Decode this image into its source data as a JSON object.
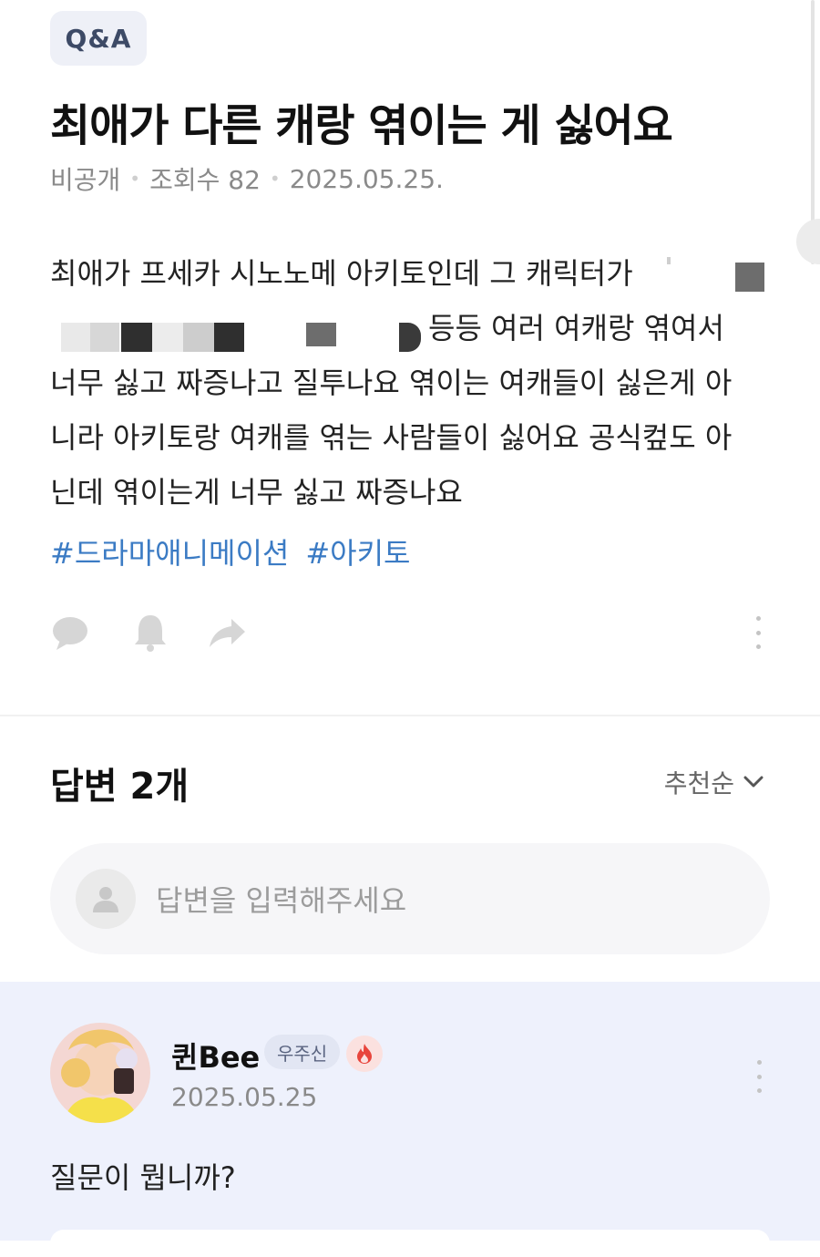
{
  "post": {
    "badge": "Q&A",
    "title": "최애가 다른 캐랑 엮이는 게 싫어요",
    "meta": {
      "visibility": "비공개",
      "views": "조회수 82",
      "date": "2025.05.25."
    },
    "body_line1": "최애가 프세카 시노노메 아키토인데 그 캐릭터가",
    "body_line2_tail": "등등 여러 여캐랑 엮여서",
    "body_line3": "너무 싫고 짜증나고 질투나요 엮이는 여캐들이 싫은게 아",
    "body_line4": "니라 아키토랑 여캐를 엮는 사람들이 싫어요 공식컾도 아",
    "body_line5": "닌데 엮이는게 너무 싫고 짜증나요",
    "tags": [
      "#드라마애니메이션",
      "#아키토"
    ]
  },
  "actions": {
    "comment_icon": "speech-bubble-icon",
    "subscribe_icon": "bell-icon",
    "share_icon": "share-arrow-icon",
    "more_icon": "kebab-menu-icon"
  },
  "answers": {
    "count_label": "답변 2개",
    "sort_label": "추천순",
    "input_placeholder": "답변을 입력해주세요"
  },
  "answer": {
    "author": "퀸Bee",
    "grade": "우주신",
    "date": "2025.05.25",
    "text": "질문이 뭡니까?"
  },
  "colors": {
    "tag": "#3b7bc4",
    "answer_bg": "#eef1fc",
    "badge_bg": "#eef0f7",
    "fire": "#e8453c"
  }
}
